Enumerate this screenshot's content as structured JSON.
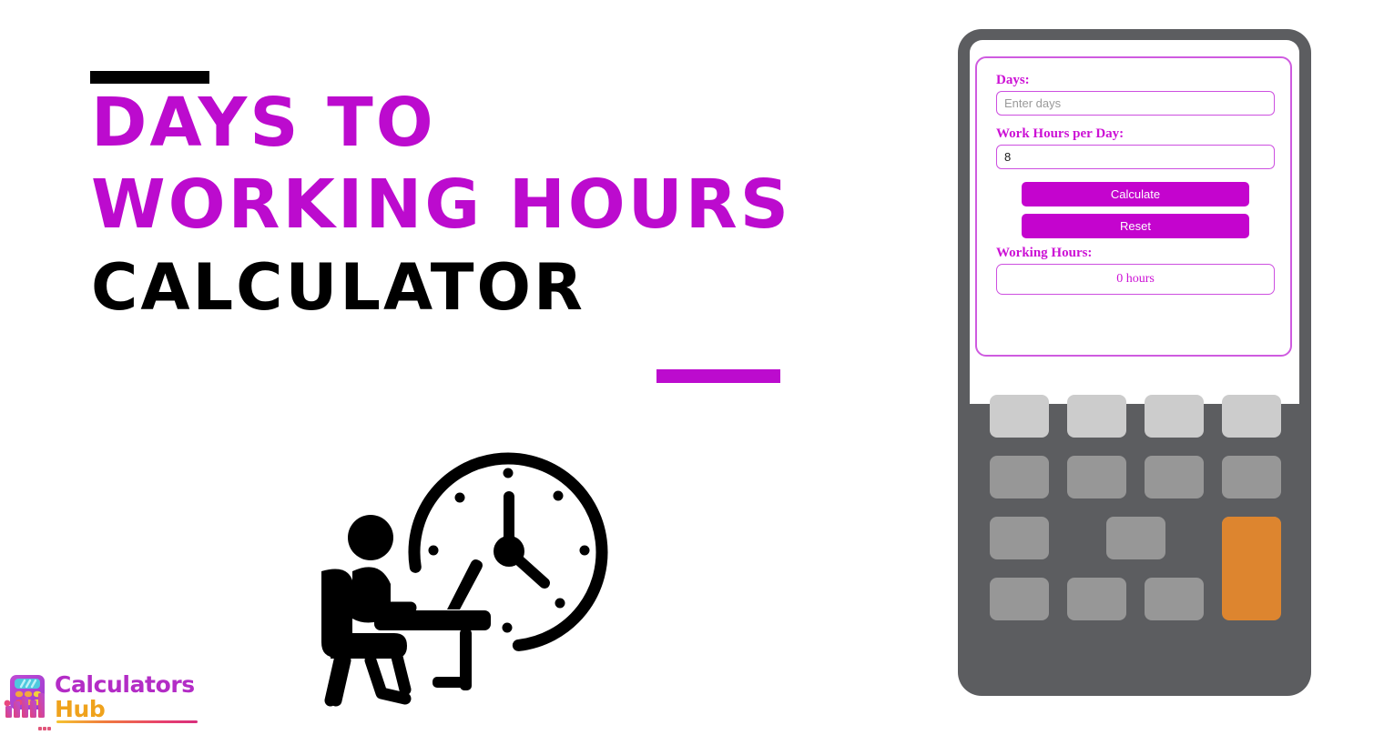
{
  "hero": {
    "title_line_1": "DAYS TO",
    "title_line_2": "WORKING HOURS",
    "title_line_3": "CALCULATOR",
    "accent_color_purple": "#BC0BCE",
    "accent_color_black": "#000000",
    "illustration_name": "person-working-at-desk-with-clock"
  },
  "logo": {
    "word_primary": "Calculators",
    "word_secondary": "Hub",
    "color_primary": "#B32CC6",
    "color_secondary": "#EFA21C"
  },
  "calculator": {
    "body_color": "#5C5D60",
    "key_light_color": "#CCCCCC",
    "key_gray_color": "#979797",
    "key_accent_color": "#DD852F",
    "form": {
      "days": {
        "label": "Days:",
        "placeholder": "Enter days",
        "value": ""
      },
      "work_hours_per_day": {
        "label": "Work Hours per Day:",
        "placeholder": "",
        "value": "8"
      },
      "calculate_label": "Calculate",
      "reset_label": "Reset",
      "result": {
        "label": "Working Hours:",
        "value": "0 hours"
      },
      "accent_color": "#C404CE",
      "border_color": "#CD4FE0",
      "label_color": "#CC11D5"
    },
    "keypad": {
      "rows": [
        [
          "key",
          "key",
          "key",
          "key"
        ],
        [
          "key",
          "key",
          "key",
          "key"
        ],
        [
          "key",
          "key",
          "key",
          "key-accent-tall"
        ],
        [
          "key",
          "key",
          "key",
          ""
        ]
      ]
    }
  }
}
